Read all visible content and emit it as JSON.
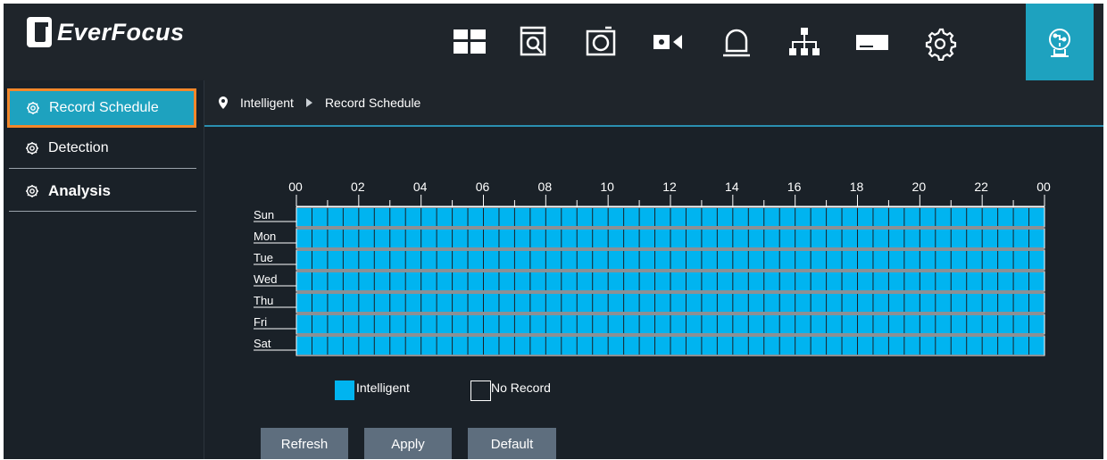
{
  "brand": {
    "name": "EverFocus"
  },
  "nav": [
    {
      "name": "live-view-icon"
    },
    {
      "name": "playback-icon"
    },
    {
      "name": "snapshot-icon"
    },
    {
      "name": "record-icon"
    },
    {
      "name": "alarm-icon"
    },
    {
      "name": "network-icon"
    },
    {
      "name": "storage-icon"
    },
    {
      "name": "settings-gear-icon"
    },
    {
      "name": "intelligent-icon",
      "active": true
    }
  ],
  "sidebar": {
    "items": [
      {
        "label": "Record Schedule",
        "active": true
      },
      {
        "label": "Detection",
        "active": false
      },
      {
        "label": "Analysis",
        "active": false
      }
    ]
  },
  "breadcrumb": {
    "root": "Intelligent",
    "current": "Record Schedule"
  },
  "schedule": {
    "hour_labels": [
      "00",
      "02",
      "04",
      "06",
      "08",
      "10",
      "12",
      "14",
      "16",
      "18",
      "20",
      "22",
      "00"
    ],
    "days": [
      "Sun",
      "Mon",
      "Tue",
      "Wed",
      "Thu",
      "Fri",
      "Sat"
    ],
    "slots_per_day": 48,
    "fill": "intelligent"
  },
  "legend": {
    "intelligent": "Intelligent",
    "no_record": "No Record"
  },
  "colors": {
    "accent": "#1ea2bf",
    "intelligent": "#00b4f0",
    "highlight": "#f2872a"
  },
  "buttons": {
    "refresh": "Refresh",
    "apply": "Apply",
    "default": "Default"
  }
}
